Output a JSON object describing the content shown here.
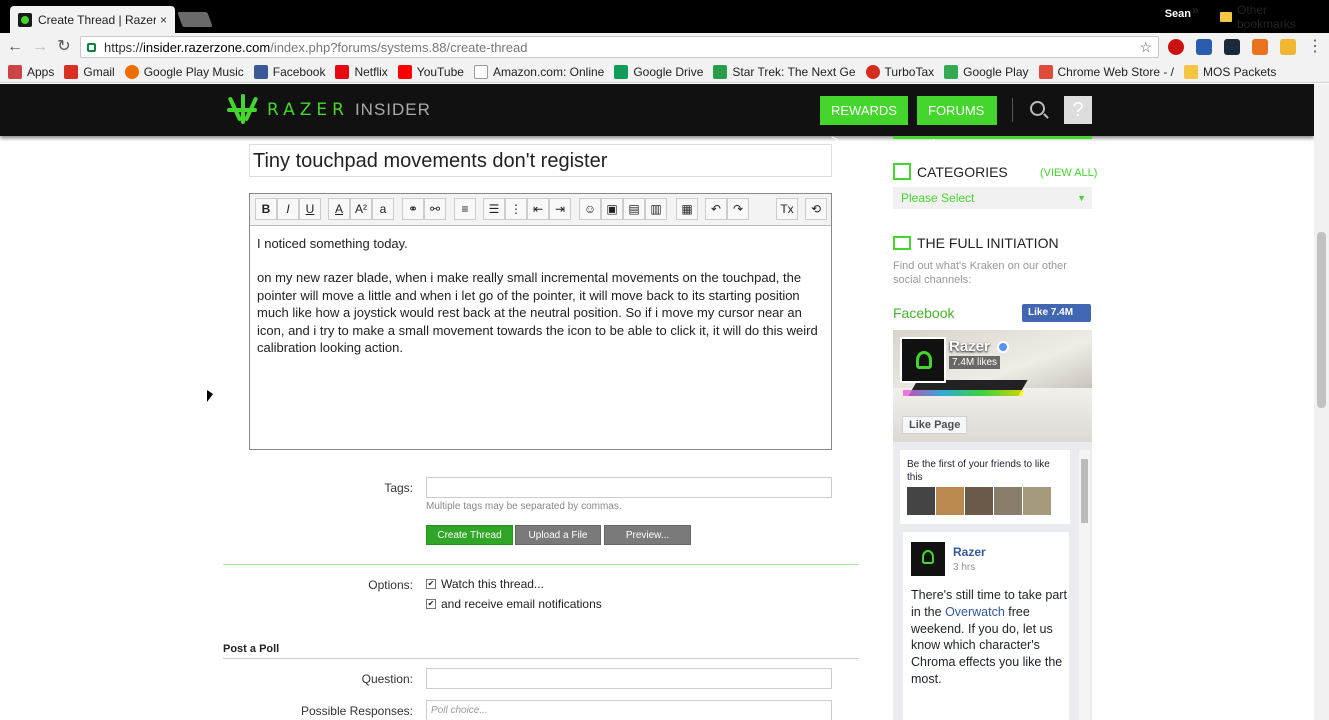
{
  "browser": {
    "tab_title": "Create Thread | Razer Ins",
    "tab_close": "×",
    "user": "Sean",
    "url_scheme": "https://",
    "url_host": "insider.razerzone.com",
    "url_path": "/index.php?forums/systems.88/create-thread",
    "bookmarks": [
      "Apps",
      "Gmail",
      "Google Play Music",
      "Facebook",
      "Netflix",
      "YouTube",
      "Amazon.com: Online",
      "Google Drive",
      "Star Trek: The Next Ge",
      "TurboTax",
      "Google Play",
      "Chrome Web Store - /",
      "MOS Packets"
    ],
    "bookmarks_more": "»",
    "other_bookmarks": "Other bookmarks"
  },
  "site": {
    "brand": "RAZER",
    "insider": "INSIDER",
    "rewards": "REWARDS >",
    "forums": "FORUMS >",
    "avatar_glyph": "?"
  },
  "form": {
    "title": "Tiny touchpad movements don't register",
    "toolbar": [
      "B",
      "I",
      "U",
      "A",
      "A²",
      "a",
      "⚭",
      "⚯",
      "≡",
      "☰",
      "⋮",
      "⇤",
      "⇥",
      "☺",
      "▣",
      "▤",
      "▥",
      "▦",
      "↶",
      "↷",
      "Tx",
      "⟲"
    ],
    "body_p1": "I noticed something today.",
    "body_p2": "on my new razer blade, when i make really small incremental movements on the touchpad, the pointer will move a little and when i let go of the pointer, it will move back to its starting position much like how a joystick would rest back at the neutral position. So if i move my cursor near an icon, and i try to make a small movement towards the icon to be able to click it, it will do this weird calibration looking action.",
    "tags_label": "Tags:",
    "tags_value": "",
    "tags_hint": "Multiple tags may be separated by commas.",
    "create_btn": "Create Thread",
    "upload_btn": "Upload a File",
    "preview_btn": "Preview...",
    "options_label": "Options:",
    "watch_label": "Watch this thread...",
    "email_label": "and receive email notifications",
    "poll_title": "Post a Poll",
    "question_label": "Question:",
    "question_value": "",
    "responses_label": "Possible Responses:",
    "responses_placeholder": "Poll choice..."
  },
  "sidebar": {
    "categories": "CATEGORIES",
    "view_all": "(VIEW ALL)",
    "select": "Please Select",
    "initiation": "THE FULL INITIATION",
    "initiation_text": "Find out what's Kraken on our other social channels:",
    "facebook": "Facebook",
    "fb_like": "Like 7.4M",
    "fb_name": "Razer",
    "fb_likes": "7.4M likes",
    "fb_likepage": "Like Page",
    "fb_friends": "Be the first of your friends to like this",
    "post_name": "Razer",
    "post_time": "3 hrs",
    "post_a": "There's still time to take part in the ",
    "post_link": "Overwatch",
    "post_b": " free weekend. If you do, let us know which character's Chroma effects you like the most."
  },
  "colors": {
    "accent": "#44d62c",
    "header": "#111111",
    "fb_blue": "#4267b2"
  }
}
